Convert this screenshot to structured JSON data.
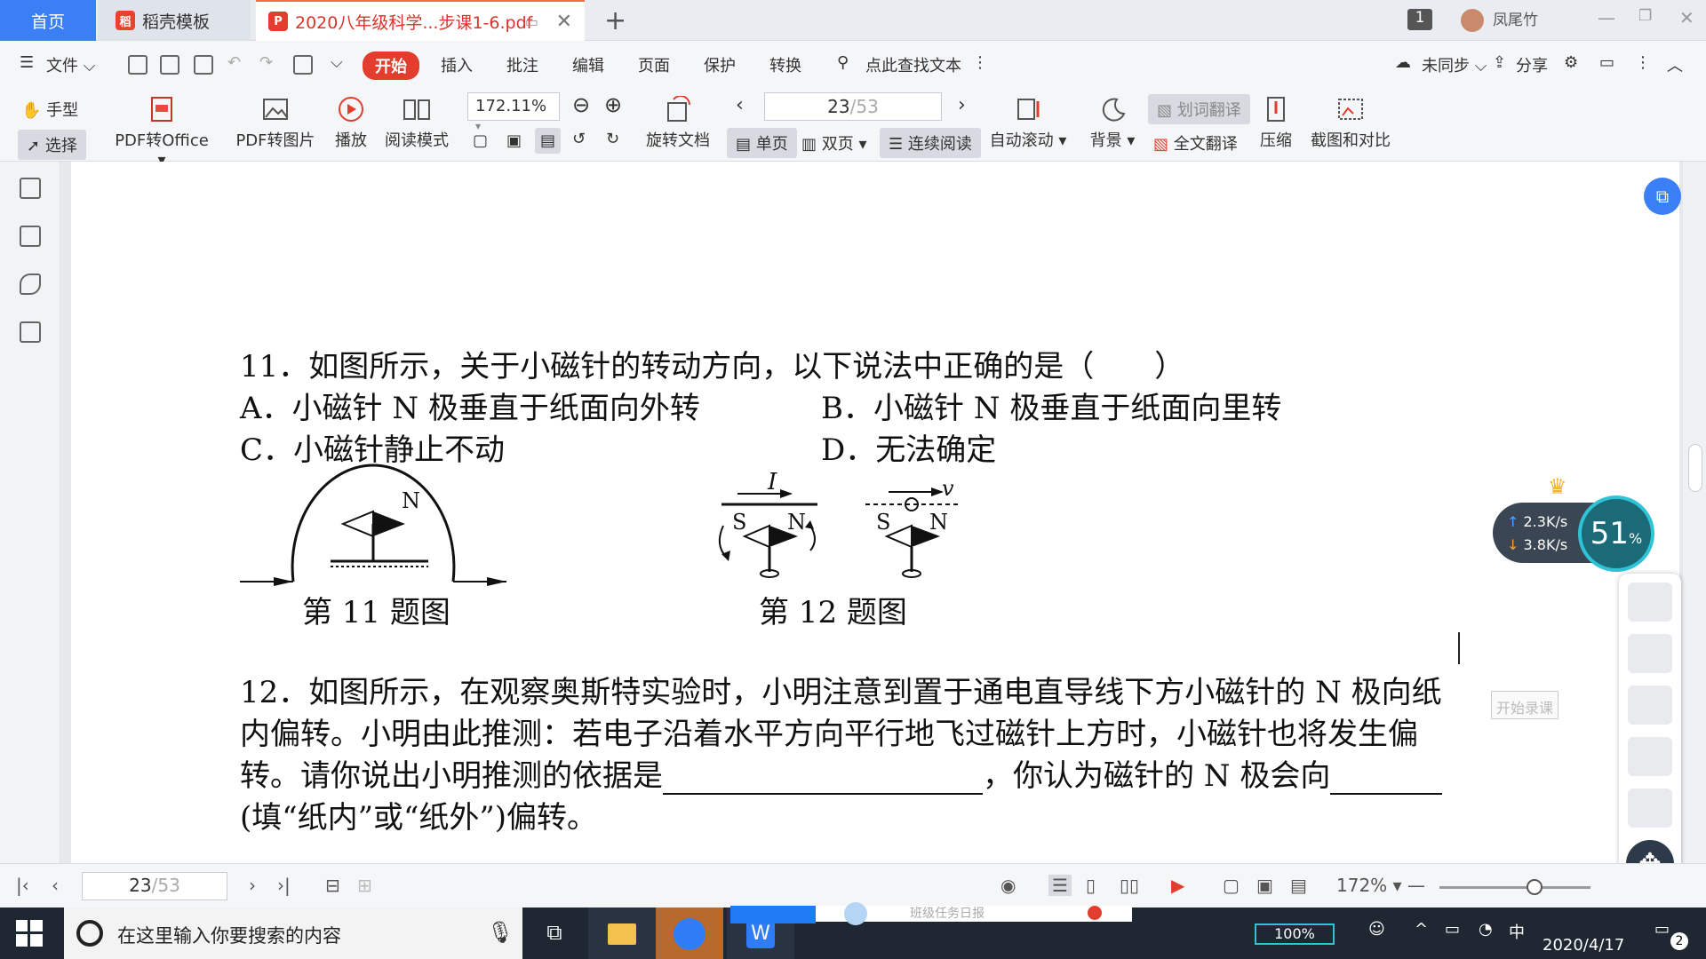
{
  "tabs": {
    "home": "首页",
    "templates": "稻壳模板",
    "document": "2020八年级科学...步课1-6.pdf"
  },
  "topbar": {
    "badge": "1",
    "user": "凤尾竹"
  },
  "menu": {
    "file": "文件",
    "items": [
      "开始",
      "插入",
      "批注",
      "编辑",
      "页面",
      "保护",
      "转换"
    ],
    "search": "点此查找文本",
    "sync": "未同步",
    "share": "分享"
  },
  "ribbon": {
    "hand": "手型",
    "select": "选择",
    "pdf_to_office": "PDF转Office",
    "pdf_to_image": "PDF转图片",
    "play": "播放",
    "read_mode": "阅读模式",
    "zoom": "172.11%",
    "rotate": "旋转文档",
    "page_current": "23",
    "page_total": "/53",
    "single": "单页",
    "double": "双页",
    "continuous": "连续阅读",
    "autoscroll": "自动滚动",
    "background": "背景",
    "word_translate": "划词翻译",
    "full_translate": "全文翻译",
    "compress": "压缩",
    "screenshot_compare": "截图和对比"
  },
  "document": {
    "q11": "11．如图所示，关于小磁针的转动方向，以下说法中正确的是（　　）",
    "q11_a": "A．小磁针 N 极垂直于纸面向外转",
    "q11_b": "B．小磁针 N 极垂直于纸面向里转",
    "q11_c": "C．小磁针静止不动",
    "q11_d": "D．无法确定",
    "fig11_caption": "第 11 题图",
    "fig12_caption": "第 12 题图",
    "fig11_n": "N",
    "fig12_i": "I",
    "fig12_v": "v",
    "fig12_s": "S",
    "fig12_n": "N",
    "q12_line1": "12．如图所示，在观察奥斯特实验时，小明注意到置于通电直导线下方小磁针的 N 极向纸",
    "q12_line2": "内偏转。小明由此推测：若电子沿着水平方向平行地飞过磁针上方时，小磁针也将发生偏",
    "q12_line3_a": "转。请你说出小明推测的依据是",
    "q12_line3_b": "，你认为磁针的 N 极会向",
    "q12_line4": "(填“纸内”或“纸外”)偏转。"
  },
  "widget": {
    "up": "2.3K/s",
    "down": "3.8K/s",
    "percent": "51",
    "percent_sign": "%",
    "record_tip": "开始录课"
  },
  "statusbar": {
    "page_current": "23",
    "page_total": "/53",
    "zoom": "172%"
  },
  "taskbar": {
    "search_placeholder": "在这里输入你要搜索的内容",
    "notification": "班级任务日报",
    "battery": "100%",
    "ime": "中",
    "date": "2020/4/17",
    "badge": "2"
  },
  "colors": {
    "accent": "#3a7ff6",
    "start": "#e33d2e",
    "taskbar": "#1f2733"
  }
}
